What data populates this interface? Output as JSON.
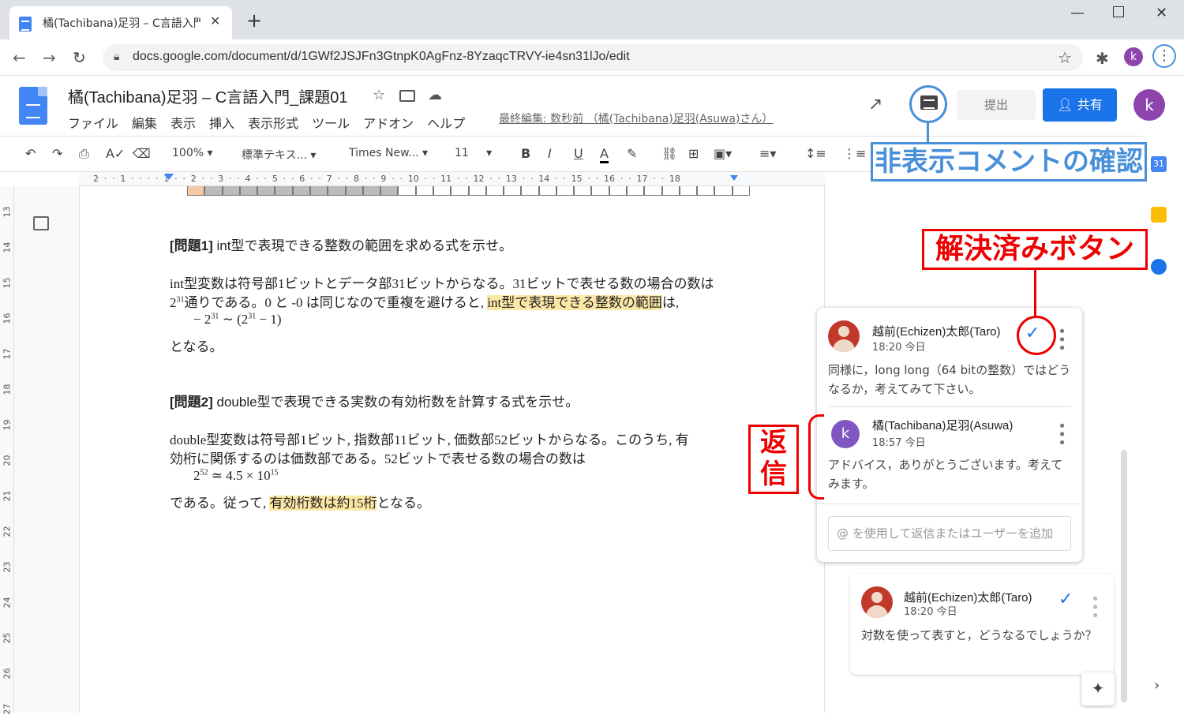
{
  "browser": {
    "tab_title": "橘(Tachibana)足羽 – C言語入門",
    "url": "docs.google.com/document/d/1GWf2JSJFn3GtnpK0AgFnz-8YzaqcTRVY-ie4sn31lJo/edit",
    "profile_initial": "k"
  },
  "docs": {
    "title": "橘(Tachibana)足羽 – C言語入門_課題01",
    "menu": [
      "ファイル",
      "編集",
      "表示",
      "挿入",
      "表示形式",
      "ツール",
      "アドオン",
      "ヘルプ"
    ],
    "last_edit": "最終編集: 数秒前 （橘(Tachibana)足羽(Asuwa)さん）",
    "submit_label": "提出",
    "share_label": "共有",
    "avatar_initial": "k"
  },
  "toolbar": {
    "zoom": "100%",
    "style": "標準テキス...",
    "font": "Times New...",
    "size": "11"
  },
  "ruler": {
    "numbers": "2 · · 1 · · · · 1 · · 2 · · 3 · · 4 · · 5 · · 6 · · 7 · · 8 · · 9 · · 10 · · 11 · · 12 · · 13 · · 14 · · 15 · · 16 · · 17 · · 18",
    "vertical": [
      "13",
      "14",
      "15",
      "16",
      "17",
      "18",
      "19",
      "20",
      "21",
      "22",
      "23",
      "24",
      "25",
      "26",
      "27"
    ]
  },
  "document": {
    "q1_label": "[問題1]",
    "q1_text": " int型で表現できる整数の範囲を求める式を示せ。",
    "p1_line1": "int型変数は符号部1ビットとデータ部31ビットからなる。31ビットで表せる数の場合の数は",
    "p1_line2_a": "2",
    "p1_line2_sup": "31",
    "p1_line2_b": "通りである。0 と -0 は同じなので重複を避けると, ",
    "p1_highlight": "int型で表現できる整数の範囲",
    "p1_line2_c": "は,",
    "formula1": "− 2",
    "formula1_sup": "31",
    "formula1_b": " ∼ (2",
    "formula1_sup2": "31",
    "formula1_c": " − 1)",
    "p1_line3": "となる。",
    "q2_label": "[問題2]",
    "q2_text": " double型で表現できる実数の有効桁数を計算する式を示せ。",
    "p2_line1": "double型変数は符号部1ビット, 指数部11ビット, 価数部52ビットからなる。このうち, 有",
    "p2_line2": "効桁に関係するのは価数部である。52ビットで表せる数の場合の数は",
    "formula2_a": "2",
    "formula2_sup": "52",
    "formula2_b": " ≃ 4.5 × 10",
    "formula2_sup2": "15",
    "p2_line3_a": "である。従って, ",
    "p2_highlight": "有効桁数は約15桁",
    "p2_line3_b": "となる。"
  },
  "comments": {
    "thread1": {
      "author": "越前(Echizen)太郎(Taro)",
      "time": "18:20 今日",
      "body": "同様に，long long（64 bitの整数）ではどうなるか，考えてみて下さい。",
      "reply_author": "橘(Tachibana)足羽(Asuwa)",
      "reply_time": "18:57 今日",
      "reply_body": "アドバイス，ありがとうございます。考えてみます。",
      "reply_initial": "k",
      "reply_placeholder": "@ を使用して返信またはユーザーを追加"
    },
    "thread2": {
      "author": "越前(Echizen)太郎(Taro)",
      "time": "18:20 今日",
      "body": "対数を使って表すと，どうなるでしょうか？"
    }
  },
  "annotations": {
    "hidden_comments": "非表示コメントの確認",
    "resolve_button": "解決済みボタン",
    "reply": "返信"
  },
  "colors": {
    "accent": "#1a73e8",
    "annotation_red": "#ee0000",
    "annotation_blue": "#4a90d9",
    "highlight": "#fce8a6"
  }
}
